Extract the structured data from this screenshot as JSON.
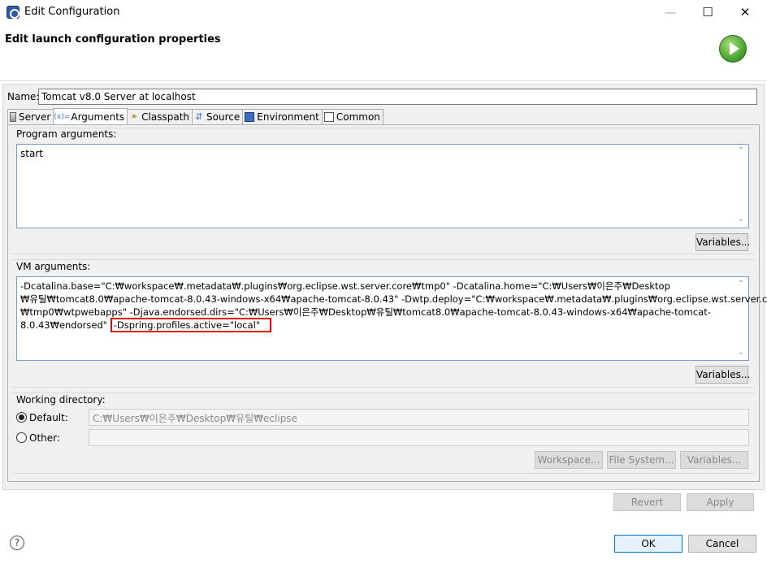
{
  "window": {
    "title": "Edit Configuration",
    "minimize_glyph": "—",
    "maximize_glyph": "☐",
    "close_glyph": "✕"
  },
  "banner": {
    "title": "Edit launch configuration properties",
    "icon": "run-icon"
  },
  "name": {
    "label": "Name:",
    "value": "Tomcat v8.0 Server at localhost"
  },
  "tabs": [
    {
      "label": "Server",
      "icon": "server-icon",
      "active": false
    },
    {
      "label": "Arguments",
      "icon": "arguments-icon",
      "active": true
    },
    {
      "label": "Classpath",
      "icon": "classpath-icon",
      "active": false
    },
    {
      "label": "Source",
      "icon": "source-icon",
      "active": false
    },
    {
      "label": "Environment",
      "icon": "environment-icon",
      "active": false
    },
    {
      "label": "Common",
      "icon": "common-icon",
      "active": false
    }
  ],
  "program_args": {
    "label": "Program arguments:",
    "value": "start",
    "variables_label": "Variables..."
  },
  "vm_args": {
    "label": "VM arguments:",
    "lines": [
      "-Dcatalina.base=\"C:₩workspace₩.metadata₩.plugins₩org.eclipse.wst.server.core₩tmp0\" -Dcatalina.home=\"C:₩Users₩이은주₩Desktop",
      "₩유틸₩tomcat8.0₩apache-tomcat-8.0.43-windows-x64₩apache-tomcat-8.0.43\" -Dwtp.deploy=\"C:₩workspace₩.metadata₩.plugins₩org.eclipse.wst.server.core",
      "₩tmp0₩wtpwebapps\" -Djava.endorsed.dirs=\"C:₩Users₩이은주₩Desktop₩유틸₩tomcat8.0₩apache-tomcat-8.0.43-windows-x64₩apache-tomcat-"
    ],
    "last_line_prefix": "8.0.43₩endorsed\"",
    "highlighted": "-Dspring.profiles.active=\"local\"",
    "variables_label": "Variables..."
  },
  "working_dir": {
    "label": "Working directory:",
    "default_label": "Default:",
    "default_value": "C:₩Users₩이은주₩Desktop₩유틸₩eclipse",
    "other_label": "Other:",
    "other_value": "",
    "workspace_label": "Workspace...",
    "filesystem_label": "File System...",
    "variables_label": "Variables..."
  },
  "footer": {
    "revert_label": "Revert",
    "apply_label": "Apply",
    "ok_label": "OK",
    "cancel_label": "Cancel",
    "help_glyph": "?"
  },
  "colors": {
    "highlight": "#e00000",
    "primary_border": "#0078d7"
  }
}
